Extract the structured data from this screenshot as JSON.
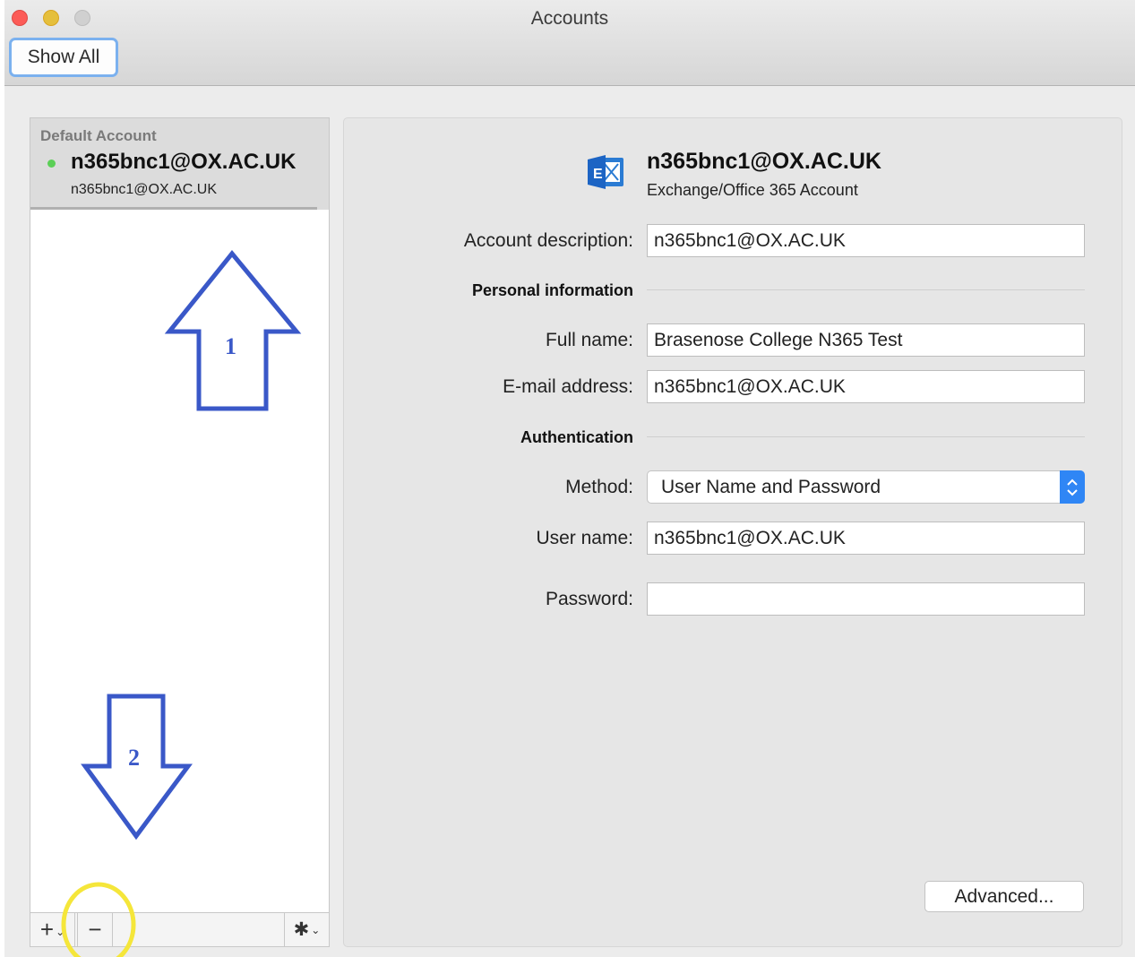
{
  "window": {
    "title": "Accounts"
  },
  "toolbar": {
    "show_all_label": "Show All"
  },
  "sidebar": {
    "section_label": "Default Account",
    "account": {
      "name": "n365bnc1@OX.AC.UK",
      "email": "n365bnc1@OX.AC.UK",
      "status_color": "#5bcf56"
    },
    "buttons": {
      "add": "+",
      "remove": "−",
      "action": "gear-icon"
    }
  },
  "header": {
    "account_name": "n365bnc1@OX.AC.UK",
    "account_type": "Exchange/Office 365 Account",
    "icon": "exchange-icon"
  },
  "form": {
    "account_description": {
      "label": "Account description:",
      "value": "n365bnc1@OX.AC.UK"
    },
    "personal_section": "Personal information",
    "full_name": {
      "label": "Full name:",
      "value": "Brasenose College N365 Test"
    },
    "email": {
      "label": "E-mail address:",
      "value": "n365bnc1@OX.AC.UK"
    },
    "auth_section": "Authentication",
    "method": {
      "label": "Method:",
      "value": "User Name and Password"
    },
    "username": {
      "label": "User name:",
      "value": "n365bnc1@OX.AC.UK"
    },
    "password": {
      "label": "Password:",
      "value": ""
    }
  },
  "advanced_label": "Advanced...",
  "annotations": {
    "arrow1_label": "1",
    "arrow2_label": "2",
    "arrow_color": "#3a58c8",
    "highlight_color": "#f5e63a"
  }
}
